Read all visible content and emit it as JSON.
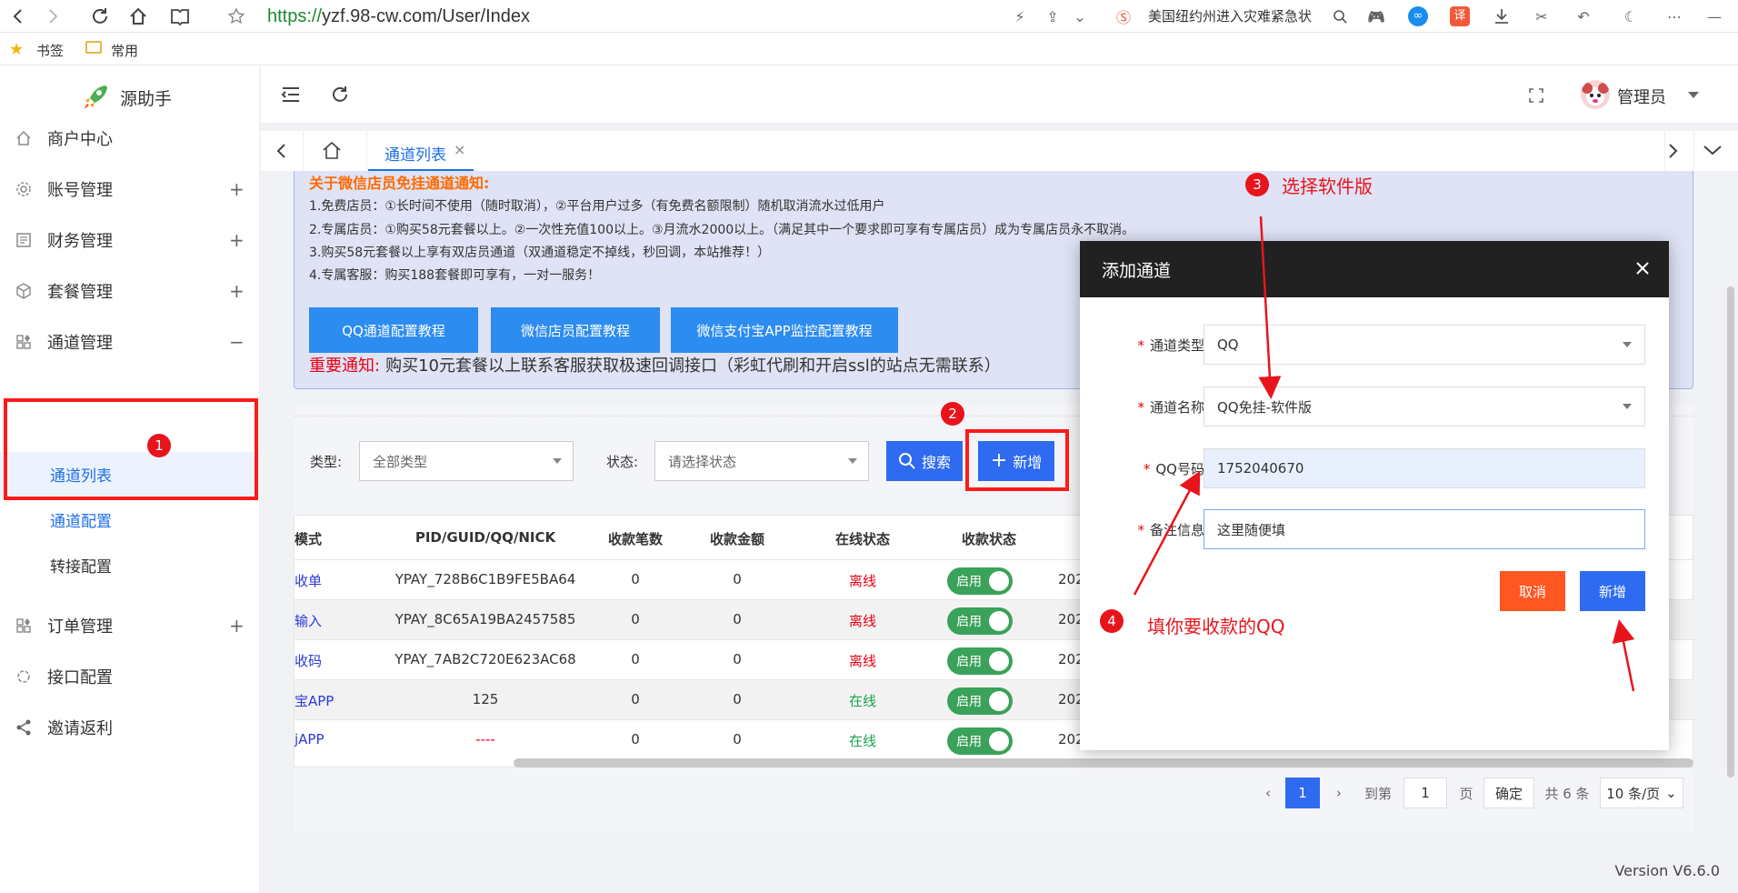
{
  "browser": {
    "url_scheme": "https://",
    "url_rest": "yzf.98-cw.com/User/Index",
    "news": "美国纽约州进入灾难紧急状",
    "bookmarks": [
      {
        "label": "书签"
      },
      {
        "label": "常用"
      }
    ]
  },
  "sidebar": {
    "brand": "源助手",
    "items": [
      {
        "label": "商户中心",
        "icon": "home-icon"
      },
      {
        "label": "账号管理",
        "icon": "gear-icon",
        "expand": "+"
      },
      {
        "label": "财务管理",
        "icon": "finance-icon",
        "expand": "+"
      },
      {
        "label": "套餐管理",
        "icon": "box-icon",
        "expand": "+"
      },
      {
        "label": "通道管理",
        "icon": "channel-icon",
        "expand": "−"
      },
      {
        "label": "订单管理",
        "icon": "order-icon",
        "expand": "+"
      },
      {
        "label": "接口配置",
        "icon": "api-icon"
      },
      {
        "label": "邀请返利",
        "icon": "share-icon"
      }
    ],
    "subitems": [
      {
        "label": "通道列表"
      },
      {
        "label": "通道配置"
      },
      {
        "label": "转接配置"
      }
    ]
  },
  "header": {
    "user": "管理员",
    "tab": "通道列表"
  },
  "notice": {
    "title": "关于微信店员免挂通道通知:",
    "lines": [
      "1.免费店员：①长时间不使用（随时取消），②平台用户过多（有免费名额限制）随机取消流水过低用户",
      "2.专属店员：①购买58元套餐以上。②一次性充值100以上。③月流水2000以上。（满足其中一个要求即可享有专属店员）成为专属店员永不取消。",
      "3.购买58元套餐以上享有双店员通道（双通道稳定不掉线，秒回调，本站推荐！）",
      "4.专属客服：购买188套餐即可享有，一对一服务！"
    ],
    "buttons": [
      {
        "label": "QQ通道配置教程"
      },
      {
        "label": "微信店员配置教程"
      },
      {
        "label": "微信支付宝APP监控配置教程"
      }
    ],
    "important_prefix": "重要通知:",
    "important_text": "购买10元套餐以上联系客服获取极速回调接口（彩虹代刷和开启ssl的站点无需联系）"
  },
  "filter": {
    "type_label": "类型:",
    "type_value": "全部类型",
    "status_label": "状态:",
    "status_value": "请选择状态",
    "search_label": "搜索",
    "add_label": "新增"
  },
  "table": {
    "headers": [
      "模式",
      "PID/GUID/QQ/NICK",
      "收款笔数",
      "收款金额",
      "在线状态",
      "收款状态",
      ""
    ],
    "rows": [
      {
        "mode": "收单",
        "pid": "YPAY_728B6C1B9FE5BA64",
        "count": "0",
        "amount": "0",
        "online": "离线",
        "status": "启用",
        "date": "202"
      },
      {
        "mode": "输入",
        "pid": "YPAY_8C65A19BA2457585",
        "count": "0",
        "amount": "0",
        "online": "离线",
        "status": "启用",
        "date": "202"
      },
      {
        "mode": "收码",
        "pid": "YPAY_7AB2C720E623AC68",
        "count": "0",
        "amount": "0",
        "online": "离线",
        "status": "启用",
        "date": "202"
      },
      {
        "mode": "宝APP",
        "pid": "125",
        "count": "0",
        "amount": "0",
        "online": "在线",
        "status": "启用",
        "date": "202"
      },
      {
        "mode": "jAPP",
        "pid": "----",
        "count": "0",
        "amount": "0",
        "online": "在线",
        "status": "启用",
        "date": "202"
      }
    ]
  },
  "pagination": {
    "page": "1",
    "goto_label": "到第",
    "goto_value": "1",
    "page_unit": "页",
    "confirm": "确定",
    "total": "共 6 条",
    "per_page": "10 条/页"
  },
  "modal": {
    "title": "添加通道",
    "fields": [
      {
        "label": "通道类型:",
        "value": "QQ"
      },
      {
        "label": "通道名称:",
        "value": "QQ免挂-软件版"
      },
      {
        "label": "QQ号码:",
        "value": "1752040670"
      },
      {
        "label": "备注信息:",
        "value": "这里随便填"
      }
    ],
    "cancel": "取消",
    "submit": "新增"
  },
  "annotations": {
    "steps": [
      "1",
      "2",
      "3",
      "4"
    ],
    "step3_text": "选择软件版",
    "step4_text": "填你要收款的QQ"
  },
  "footer": {
    "version": "Version V6.6.0"
  },
  "colors": {
    "primary": "#2f6bf0",
    "danger": "#e60012",
    "success": "#3aa25a",
    "modal_head": "#212121",
    "cancel": "#ff5722"
  }
}
